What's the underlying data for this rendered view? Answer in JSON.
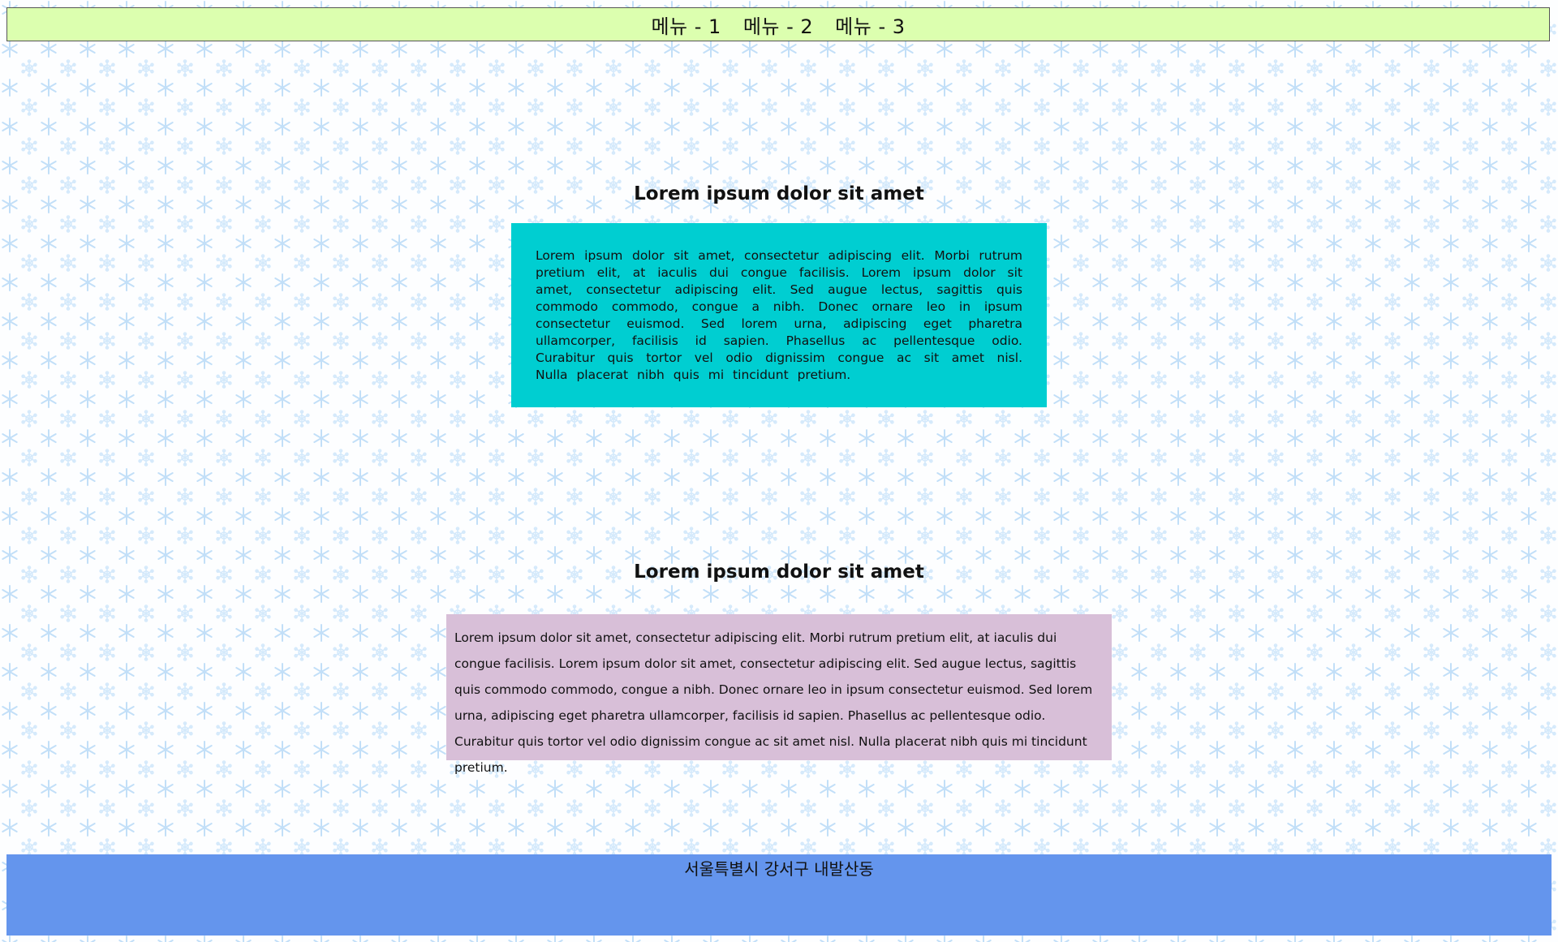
{
  "nav": {
    "items": [
      {
        "label": "메뉴 - 1"
      },
      {
        "label": "메뉴 - 2"
      },
      {
        "label": "메뉴 - 3"
      }
    ]
  },
  "sections": [
    {
      "title": "Lorem ipsum dolor sit amet",
      "body": "Lorem ipsum dolor sit amet, consectetur adipiscing elit. Morbi rutrum pretium elit, at iaculis dui congue facilisis. Lorem ipsum dolor sit amet, consectetur adipiscing elit. Sed augue lectus, sagittis quis commodo commodo, congue a nibh. Donec ornare leo in ipsum consectetur euismod. Sed lorem urna, adipiscing eget pharetra ullamcorper, facilisis id sapien. Phasellus ac pellentesque odio. Curabitur quis tortor vel odio dignissim congue ac sit amet nisl. Nulla placerat nibh quis mi tincidunt pretium."
    },
    {
      "title": "Lorem ipsum dolor sit amet",
      "body": "Lorem ipsum dolor sit amet, consectetur adipiscing elit. Morbi rutrum pretium elit, at iaculis dui congue facilisis. Lorem ipsum dolor sit amet, consectetur adipiscing elit. Sed augue lectus, sagittis quis commodo commodo, congue a nibh. Donec ornare leo in ipsum consectetur euismod. Sed lorem urna, adipiscing eget pharetra ullamcorper, facilisis id sapien. Phasellus ac pellentesque odio. Curabitur quis tortor vel odio dignissim congue ac sit amet nisl. Nulla placerat nibh quis mi tincidunt pretium."
    }
  ],
  "footer": {
    "address": "서울특별시 강서구 내발산동"
  },
  "colors": {
    "nav_bg": "#dcffaf",
    "box1_bg": "#00ced1",
    "box2_bg": "#d8bfd8",
    "footer_bg": "#6495ed",
    "snowflake": "#cde6fa"
  }
}
